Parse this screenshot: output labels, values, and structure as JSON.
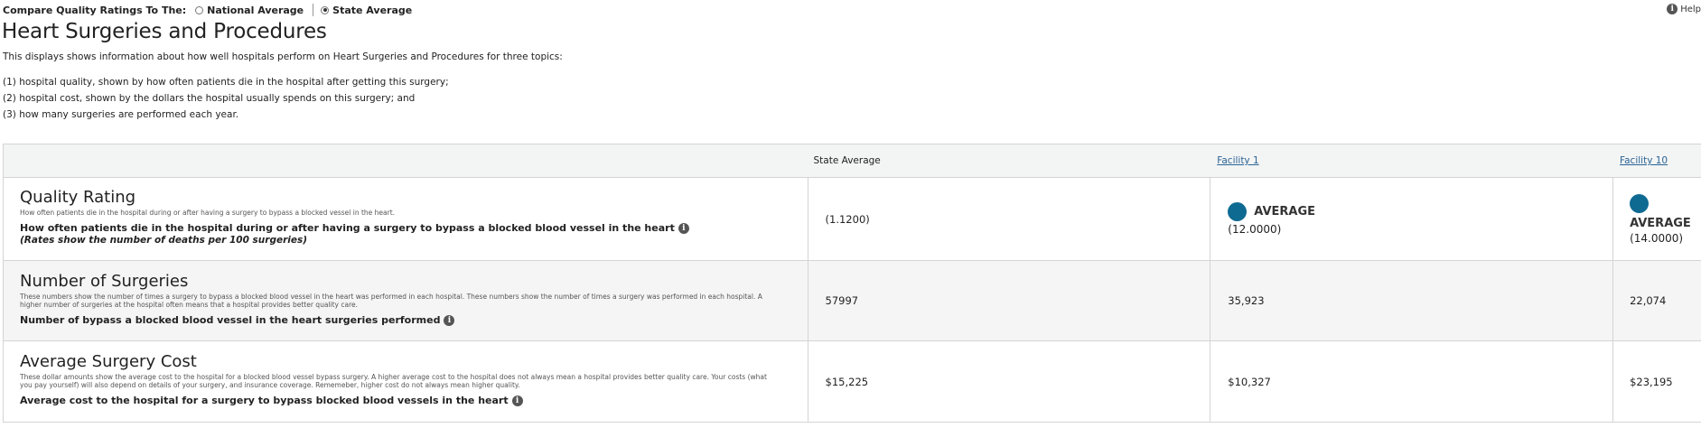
{
  "compare": {
    "label": "Compare Quality Ratings To The:",
    "options": [
      "National Average",
      "State Average"
    ],
    "selected": "State Average"
  },
  "help": {
    "label": "Help",
    "icon": "info-icon"
  },
  "page": {
    "title": "Heart Surgeries and Procedures",
    "intro": "This displays shows information about how well hospitals perform on Heart Surgeries and Procedures for three topics:",
    "topics": [
      "(1) hospital quality, shown by how often patients die in the hospital after getting this surgery;",
      "(2) hospital cost, shown by the dollars the hospital usually spends on this surgery; and",
      "(3) how many surgeries are performed each year."
    ]
  },
  "table": {
    "columns": [
      "",
      "State Average",
      "Facility 1",
      "Facility 10"
    ],
    "rows": [
      {
        "title": "Quality Rating",
        "description": "How often patients die in the hospital during or after having a surgery to bypass a blocked vessel in the heart.",
        "label": "How often patients die in the hospital during or after having a surgery to bypass a blocked blood vessel in the heart",
        "note": "(Rates show the number of deaths per 100 surgeries)",
        "state_average": "(1.1200)",
        "facility1": {
          "rating": "AVERAGE",
          "value": "(12.0000)"
        },
        "facility10": {
          "rating": "AVERAGE",
          "value": "(14.0000)"
        }
      },
      {
        "title": "Number of Surgeries",
        "description": "These numbers show the number of times a surgery to bypass a blocked blood vessel in the heart was performed in each hospital. These numbers show the number of times a surgery was performed in each hospital. A higher number of surgeries at the hospital often means that a hospital provides better quality care.",
        "label": "Number of bypass a blocked blood vessel in the heart surgeries performed",
        "state_average": "57997",
        "facility1": "35,923",
        "facility10": "22,074"
      },
      {
        "title": "Average Surgery Cost",
        "description": "These dollar amounts show the average cost to the hospital for a blocked blood vessel bypass surgery. A higher average cost to the hospital does not always mean a hospital provides better quality care. Your costs (what you pay yourself) will also depend on details of your surgery, and insurance coverage. Rememeber, higher cost do not always mean higher quality.",
        "label": "Average cost to the hospital for a surgery to bypass blocked blood vessels in the heart",
        "state_average": "$15,225",
        "facility1": "$10,327",
        "facility10": "$23,195"
      }
    ]
  },
  "colors": {
    "rating_dot": "#0f6a92",
    "link": "#2a6496",
    "header_bg": "#f3f4f4"
  }
}
